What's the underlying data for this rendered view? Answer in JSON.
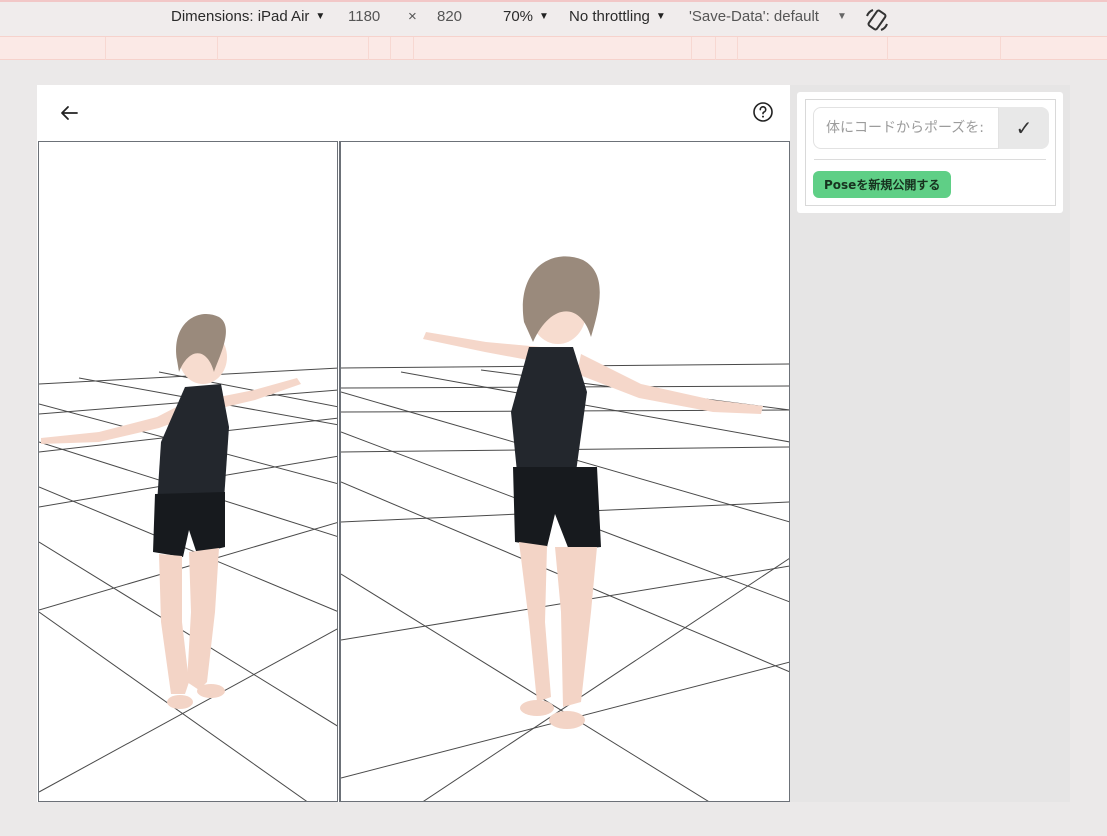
{
  "devtools": {
    "dimensions_label": "Dimensions: iPad Air",
    "width": "1180",
    "times": "×",
    "height": "820",
    "zoom": "70%",
    "throttling": "No throttling",
    "save_data": "'Save-Data': default",
    "caret": "▼"
  },
  "header": {
    "back_icon": "arrow-left-icon",
    "help_icon": "question-circle-icon"
  },
  "viewports": [
    {
      "name": "front-view",
      "content": "3d-character-t-pose"
    },
    {
      "name": "perspective-view",
      "content": "3d-character-t-pose"
    }
  ],
  "side_panel": {
    "code_input_placeholder": "体にコードからポーズを:",
    "confirm_symbol": "✓",
    "publish_label": "Poseを新規公開する"
  },
  "colors": {
    "publish_button": "#5fcf86",
    "canvas_border": "#6c7178",
    "hair": "#9a8a7c",
    "top": "#22262c",
    "skin": "#f6d8cb"
  }
}
